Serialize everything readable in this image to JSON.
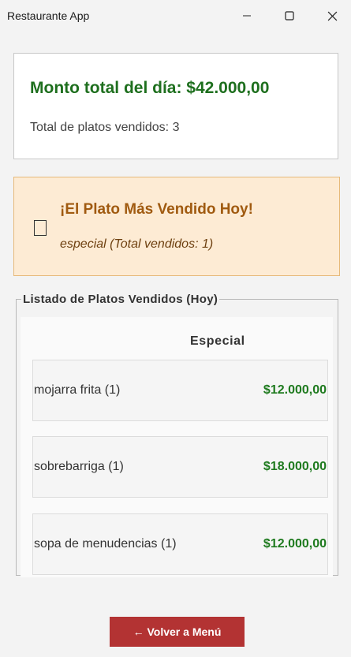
{
  "window": {
    "title": "Restaurante App"
  },
  "summary": {
    "total_label": "Monto total del día: $42.000,00",
    "platos_label": "Total de platos vendidos: 3"
  },
  "top_dish": {
    "title": "¡El Plato Más Vendido Hoy!",
    "subtitle": "especial (Total vendidos: 1)"
  },
  "list": {
    "legend": "Listado de Platos Vendidos (Hoy)",
    "category": "Especial",
    "items": [
      {
        "name": "mojarra frita (1)",
        "price": "$12.000,00"
      },
      {
        "name": "sobrebarriga (1)",
        "price": "$18.000,00"
      },
      {
        "name": "sopa de menudencias (1)",
        "price": "$12.000,00"
      }
    ]
  },
  "back_button": {
    "label": "← Volver a Menú"
  }
}
